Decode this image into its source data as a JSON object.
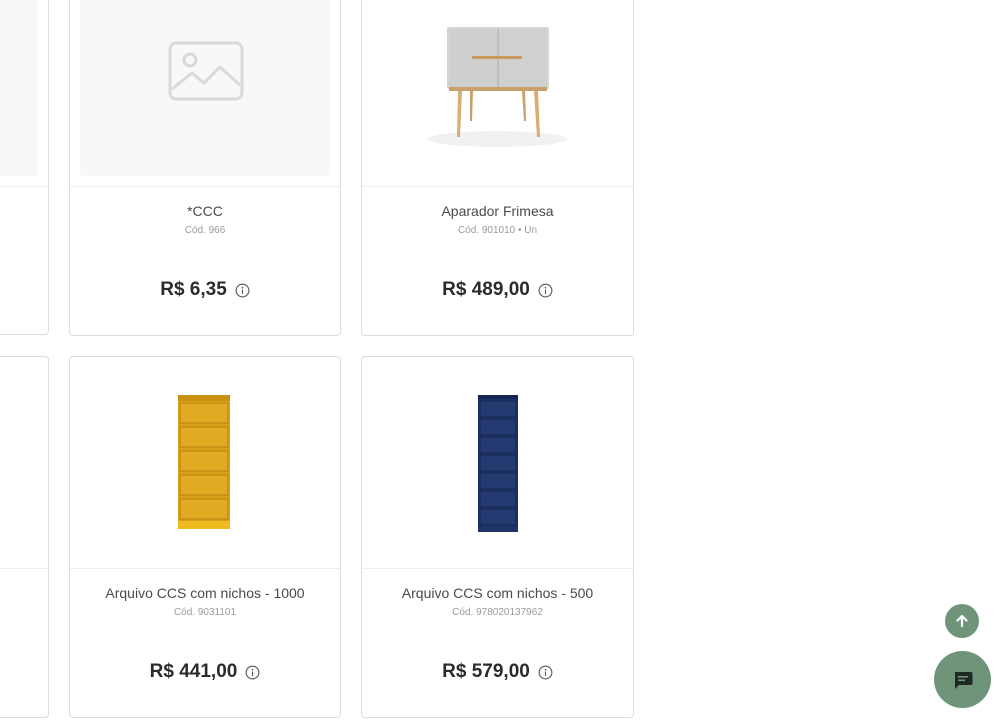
{
  "products": [
    {
      "name": "*CCC",
      "code": "Cód. 966",
      "price": "R$ 6,35",
      "image": "image-placeholder-icon"
    },
    {
      "name": "Aparador Frimesa",
      "code": "Cód. 901010 • Un",
      "price": "R$ 489,00",
      "image": "side-table-product"
    },
    {
      "name": "Arquivo CCS com nichos - 1000",
      "code": "Cód. 9031101",
      "price": "R$ 441,00",
      "image": "yellow-filing-cabinet"
    },
    {
      "name": "Arquivo CCS com nichos - 500",
      "code": "Cód. 978020137962",
      "price": "R$ 579,00",
      "image": "navy-filing-cabinet"
    }
  ],
  "actions": {
    "scroll_top_icon": "arrow-up-icon",
    "chat_icon": "chat-bubble-icon"
  },
  "colors": {
    "accent": "#6f9479",
    "price_text": "#2b2b2b",
    "border": "#dcdcdc"
  }
}
